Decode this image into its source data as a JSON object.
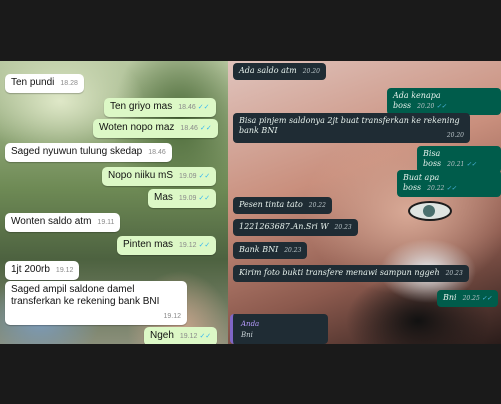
{
  "left_chat": {
    "messages": [
      {
        "text": "Ten pundi",
        "time": "18.28",
        "dir": "in"
      },
      {
        "text": "Ten griyo mas",
        "time": "18.46",
        "dir": "out"
      },
      {
        "text": "Woten nopo maz",
        "time": "18.46",
        "dir": "out"
      },
      {
        "text": "Saged nyuwun tulung skedap",
        "time": "18.46",
        "dir": "in"
      },
      {
        "text": "Nopo niiku mS",
        "time": "19.09",
        "dir": "out"
      },
      {
        "text": "Mas",
        "time": "19.09",
        "dir": "out"
      },
      {
        "text": "Wonten saldo atm",
        "time": "19.11",
        "dir": "in"
      },
      {
        "text": "Pinten mas",
        "time": "19.12",
        "dir": "out"
      },
      {
        "text": "1jt 200rb",
        "time": "19.12",
        "dir": "in"
      },
      {
        "text": "Saged ampil saldone damel transferkan ke rekening bank BNI",
        "time": "19.12",
        "dir": "in"
      },
      {
        "text": "Ngeh",
        "time": "19.12",
        "dir": "out"
      }
    ]
  },
  "right_chat": {
    "messages": [
      {
        "text": "Ada saldo atm",
        "time": "20.20",
        "dir": "in"
      },
      {
        "text": "Ada kenapa boss",
        "time": "20.20",
        "dir": "out"
      },
      {
        "text": "Bisa pinjem saldonya 2jt buat transferkan ke rekening bank BNI",
        "time": "20.20",
        "dir": "in"
      },
      {
        "text": "Bisa boss",
        "time": "20.21",
        "dir": "out"
      },
      {
        "text": "Buat apa boss",
        "time": "20.22",
        "dir": "out"
      },
      {
        "text": "Pesen tinta tato",
        "time": "20.22",
        "dir": "in"
      },
      {
        "text": "1221263687.An.Sri W",
        "time": "20.23",
        "dir": "in"
      },
      {
        "text": "Bank BNI",
        "time": "20.23",
        "dir": "in"
      },
      {
        "text": "Kirim foto bukti transfere menawi sampun nggeh",
        "time": "20.23",
        "dir": "in"
      },
      {
        "text": "Bni",
        "time": "20.25",
        "dir": "out"
      }
    ],
    "reply_preview": {
      "name": "Anda",
      "text": "Bni"
    }
  },
  "colors": {
    "left_out_bubble": "#dcf8c6",
    "left_in_bubble": "#ffffff",
    "right_out_bubble": "#005c4b",
    "right_in_bubble": "#1f2c34",
    "tick": "#34b7f1"
  },
  "icons": {
    "read_receipt": "double-check-icon"
  }
}
